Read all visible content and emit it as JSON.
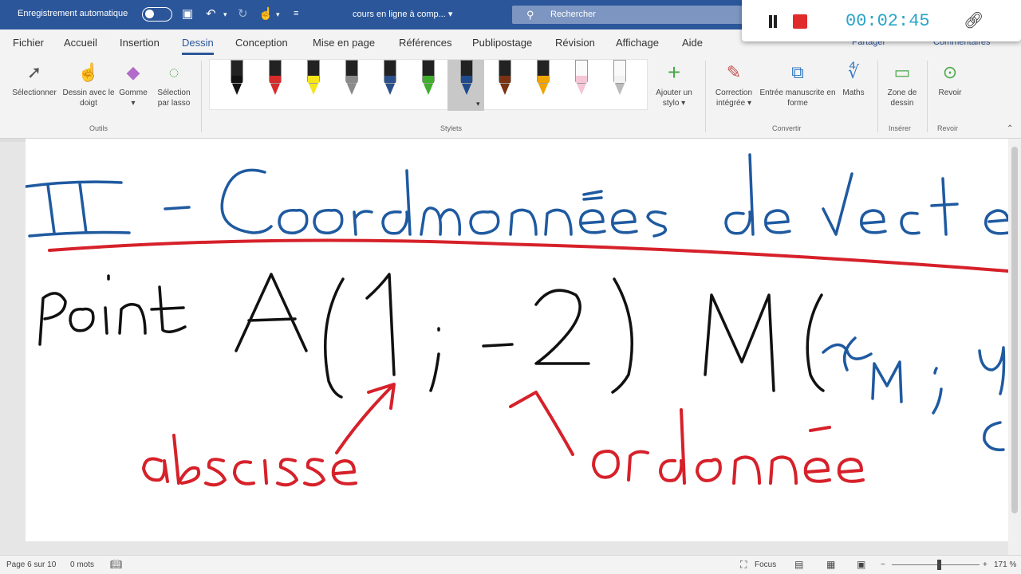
{
  "titlebar": {
    "autosave_label": "Enregistrement automatique",
    "doc_name": "cours en ligne à comp... ▾",
    "search_placeholder": "Rechercher"
  },
  "recorder": {
    "timer": "00:02:45"
  },
  "tabs": [
    {
      "label": "Fichier"
    },
    {
      "label": "Accueil"
    },
    {
      "label": "Insertion"
    },
    {
      "label": "Dessin"
    },
    {
      "label": "Conception"
    },
    {
      "label": "Mise en page"
    },
    {
      "label": "Références"
    },
    {
      "label": "Publipostage"
    },
    {
      "label": "Révision"
    },
    {
      "label": "Affichage"
    },
    {
      "label": "Aide"
    }
  ],
  "share_label": "Partager",
  "comments_label": "Commentaires",
  "ribbon": {
    "select": "Sélectionner",
    "finger_draw": "Dessin avec le doigt",
    "eraser": "Gomme",
    "lasso": "Sélection par lasso",
    "tools_group": "Outils",
    "pens_group": "Stylets",
    "add_pen": "Ajouter un stylo",
    "ink_correction": "Correction intégrée",
    "ink_to_shape": "Entrée manuscrite en forme",
    "math": "Maths",
    "convert_group": "Convertir",
    "canvas": "Zone de dessin",
    "insert_group": "Insérer",
    "replay": "Revoir",
    "replay_group": "Revoir",
    "pen_colors": [
      "#111111",
      "#d62b2b",
      "#f5e51c",
      "#8a8a8a",
      "#2b4f8a",
      "#3fae2c",
      "#1f4b8c",
      "#7a3312",
      "#f0a400",
      "#f4c6d6",
      "#f2f2f2"
    ]
  },
  "ink": {
    "title_color": "#1f5aa0",
    "text_color": "#111111",
    "note_color": "#d6202a"
  },
  "status": {
    "page": "Page 6 sur 10",
    "words": "0 mots",
    "focus": "Focus",
    "zoom": "171 %"
  }
}
